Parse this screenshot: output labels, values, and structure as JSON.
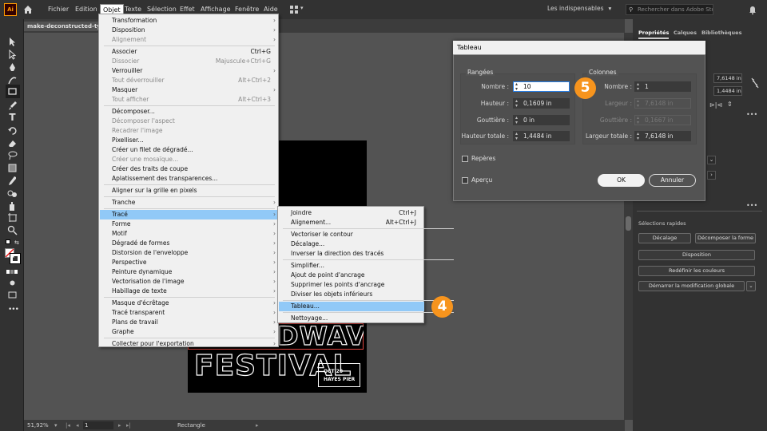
{
  "app": {
    "logo": "Ai",
    "workspace": "Les indispensables",
    "search_placeholder": "Rechercher dans Adobe Stock"
  },
  "menubar": [
    "Fichier",
    "Edition",
    "Objet",
    "Texte",
    "Sélection",
    "Effet",
    "Affichage",
    "Fenêtre",
    "Aide"
  ],
  "document": {
    "tab": "make-deconstructed-type..."
  },
  "objet_menu": [
    {
      "label": "Transformation",
      "arrow": true
    },
    {
      "label": "Disposition",
      "arrow": true
    },
    {
      "label": "Alignement",
      "arrow": true,
      "disabled": true
    },
    {
      "sep": true
    },
    {
      "label": "Associer",
      "shortcut": "Ctrl+G"
    },
    {
      "label": "Dissocier",
      "shortcut": "Majuscule+Ctrl+G",
      "disabled": true
    },
    {
      "label": "Verrouiller",
      "arrow": true
    },
    {
      "label": "Tout déverrouiller",
      "shortcut": "Alt+Ctrl+2",
      "disabled": true
    },
    {
      "label": "Masquer",
      "arrow": true
    },
    {
      "label": "Tout afficher",
      "shortcut": "Alt+Ctrl+3",
      "disabled": true
    },
    {
      "sep": true
    },
    {
      "label": "Décomposer..."
    },
    {
      "label": "Décomposer l'aspect",
      "disabled": true
    },
    {
      "label": "Recadrer l'image",
      "disabled": true
    },
    {
      "label": "Pixelliser..."
    },
    {
      "label": "Créer un filet de dégradé..."
    },
    {
      "label": "Créer une mosaïque...",
      "disabled": true
    },
    {
      "label": "Créer des traits de coupe"
    },
    {
      "label": "Aplatissement des transparences..."
    },
    {
      "sep": true
    },
    {
      "label": "Aligner sur la grille en pixels"
    },
    {
      "sep": true
    },
    {
      "label": "Tranche",
      "arrow": true
    },
    {
      "sep": true
    },
    {
      "label": "Tracé",
      "arrow": true,
      "highlight": true
    },
    {
      "label": "Forme",
      "arrow": true
    },
    {
      "label": "Motif",
      "arrow": true
    },
    {
      "label": "Dégradé de formes",
      "arrow": true
    },
    {
      "label": "Distorsion de l'enveloppe",
      "arrow": true
    },
    {
      "label": "Perspective",
      "arrow": true
    },
    {
      "label": "Peinture dynamique",
      "arrow": true
    },
    {
      "label": "Vectorisation de l'image",
      "arrow": true
    },
    {
      "label": "Habillage de texte",
      "arrow": true
    },
    {
      "sep": true
    },
    {
      "label": "Masque d'écrêtage",
      "arrow": true
    },
    {
      "label": "Tracé transparent",
      "arrow": true
    },
    {
      "label": "Plans de travail",
      "arrow": true
    },
    {
      "label": "Graphe",
      "arrow": true
    },
    {
      "sep": true
    },
    {
      "label": "Collecter pour l'exportation",
      "arrow": true
    }
  ],
  "trace_submenu": [
    {
      "label": "Joindre",
      "shortcut": "Ctrl+J"
    },
    {
      "label": "Alignement...",
      "shortcut": "Alt+Ctrl+J"
    },
    {
      "sep": true
    },
    {
      "label": "Vectoriser le contour"
    },
    {
      "label": "Décalage..."
    },
    {
      "label": "Inverser la direction des tracés"
    },
    {
      "sep": true
    },
    {
      "label": "Simplifier..."
    },
    {
      "label": "Ajout de point d'ancrage"
    },
    {
      "label": "Supprimer les points d'ancrage"
    },
    {
      "label": "Diviser les objets inférieurs"
    },
    {
      "sep": true
    },
    {
      "label": "Tableau...",
      "highlight": true
    },
    {
      "sep": true
    },
    {
      "label": "Nettoyage..."
    }
  ],
  "dialog": {
    "title": "Tableau",
    "rows": {
      "header": "Rangées",
      "nombre_label": "Nombre :",
      "nombre": "10",
      "hauteur_label": "Hauteur :",
      "hauteur": "0,1609 in",
      "gouttiere_label": "Gouttière :",
      "gouttiere": "0 in",
      "total_label": "Hauteur totale :",
      "total": "1,4484 in"
    },
    "cols": {
      "header": "Colonnes",
      "nombre_label": "Nombre :",
      "nombre": "1",
      "largeur_label": "Largeur :",
      "largeur": "7,6148 in",
      "gouttiere_label": "Gouttière :",
      "gouttiere": "0,1667 in",
      "total_label": "Largeur totale :",
      "total": "7,6148 in"
    },
    "reperes": "Repères",
    "apercu": "Aperçu",
    "ok": "OK",
    "annuler": "Annuler"
  },
  "badges": {
    "step4": "4",
    "step5": "5"
  },
  "artboard": {
    "line1": "SOUNDWAVE",
    "line2": "FESTIVAL",
    "date": "OCT 20",
    "place": "HAYES PIER"
  },
  "status": {
    "zoom": "51,92%",
    "page": "1",
    "tool": "Rectangle"
  },
  "right_panel": {
    "tabs": [
      "Propriétés",
      "Calques",
      "Bibliothèques"
    ],
    "w": "7,6148 in",
    "h": "1,4484 in",
    "quick_actions": "Sélections rapides",
    "btn_decalage": "Décalage",
    "btn_decomposer": "Décomposer la forme",
    "btn_disposition": "Disposition",
    "btn_redefinir": "Redéfinir les couleurs",
    "btn_modif": "Démarrer la modification globale"
  },
  "colors": {
    "badge": "#f7941d",
    "highlight": "#91c9f7"
  }
}
